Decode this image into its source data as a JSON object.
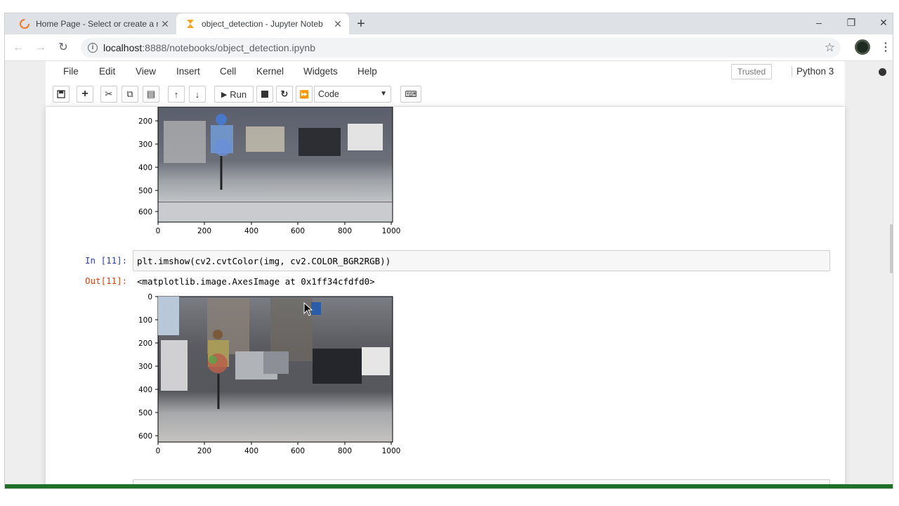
{
  "browser": {
    "tabs": [
      {
        "title": "Home Page - Select or create a n",
        "icon": "jupyter-spinner-icon",
        "active": false
      },
      {
        "title": "object_detection - Jupyter Noteb",
        "icon": "hourglass-icon",
        "active": true
      }
    ],
    "url_host": "localhost",
    "url_path": ":8888/notebooks/object_detection.ipynb"
  },
  "jupyter": {
    "menu": [
      "File",
      "Edit",
      "View",
      "Insert",
      "Cell",
      "Kernel",
      "Widgets",
      "Help"
    ],
    "trusted_label": "Trusted",
    "kernel_name": "Python 3",
    "run_label": "Run",
    "cell_type": "Code"
  },
  "cells": {
    "top_plot": {
      "y_ticks": [
        "200",
        "300",
        "400",
        "500",
        "600"
      ],
      "x_ticks": [
        "0",
        "200",
        "400",
        "600",
        "800",
        "1000"
      ]
    },
    "cell11": {
      "in_prompt": "In [11]:",
      "code": "plt.imshow(cv2.cvtColor(img, cv2.COLOR_BGR2RGB))",
      "out_prompt": "Out[11]:",
      "output": "<matplotlib.image.AxesImage at 0x1ff34cfdfd0>",
      "y_ticks": [
        "0",
        "100",
        "200",
        "300",
        "400",
        "500",
        "600"
      ],
      "x_ticks": [
        "0",
        "200",
        "400",
        "600",
        "800",
        "1000"
      ]
    }
  },
  "colors": {
    "in_prompt": "#303f9f",
    "out_prompt": "#d84315",
    "status_bar": "#1e6f28"
  }
}
